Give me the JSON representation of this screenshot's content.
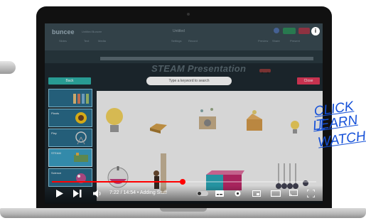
{
  "app": {
    "logo": "buncee",
    "logo_sub": "Untitled Buncee",
    "doc_title": "Untitled",
    "ribbon": [
      "Slides",
      "Text",
      "Media",
      "Settings",
      "Record",
      "Preview",
      "Share",
      "Present"
    ],
    "slide_title": "STEAM Presentation"
  },
  "search": {
    "back_label": "Back",
    "placeholder": "Type a keyword to search",
    "close_label": "Close"
  },
  "sidebar": {
    "categories": [
      {
        "label": ""
      },
      {
        "label": "Plants"
      },
      {
        "label": "Play"
      },
      {
        "label": "STEAM"
      },
      {
        "label": "Science"
      }
    ]
  },
  "player": {
    "time": "7:22 / 14:54",
    "chapter": "Adding Stuff",
    "time_display": "7:22 / 14:54 • Adding Stuff",
    "progress_fraction": 0.495,
    "info_label": "i",
    "accent": "#ff0000"
  },
  "cta": {
    "line1": "CLICK T",
    "line2": "LEARN",
    "line3": "WATCH",
    "color": "#1450d8"
  },
  "icons": [
    "play-icon",
    "next-icon",
    "volume-icon",
    "autoplay-toggle",
    "subtitles-icon",
    "settings-icon",
    "miniplayer-icon",
    "theater-icon",
    "cast-icon",
    "fullscreen-icon",
    "info-icon"
  ]
}
